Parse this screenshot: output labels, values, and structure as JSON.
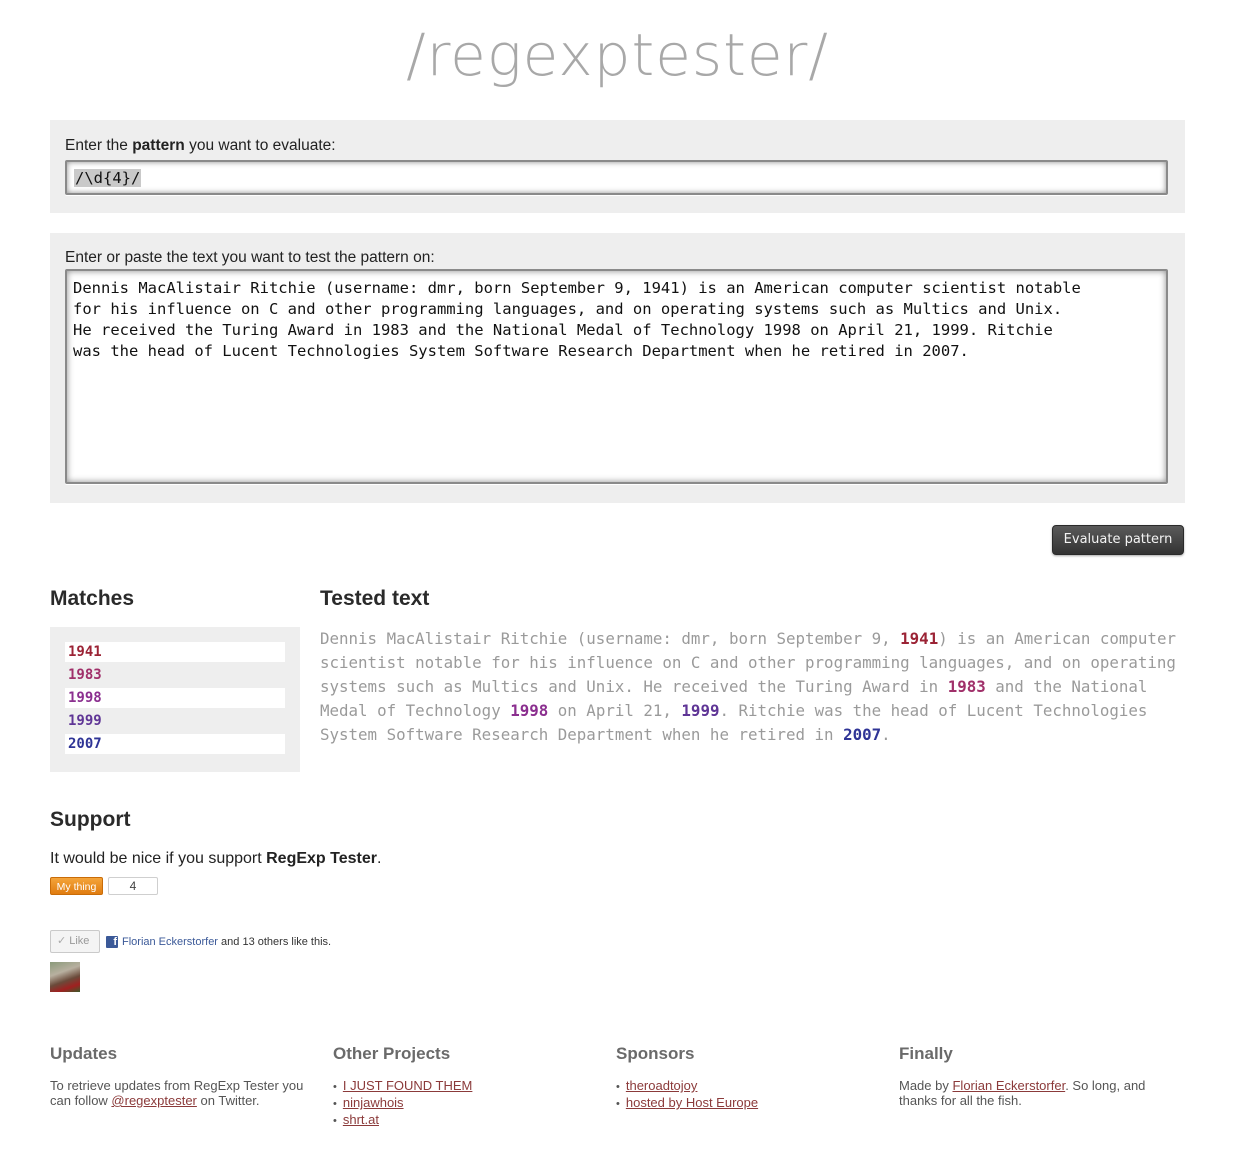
{
  "logo": "/regexptester/",
  "pattern_panel": {
    "label_pre": "Enter the ",
    "label_bold": "pattern",
    "label_post": " you want to evaluate:",
    "value": "/\\d{4}/"
  },
  "text_panel": {
    "label": "Enter or paste the text you want to test the pattern on:",
    "value": "Dennis MacAlistair Ritchie (username: dmr, born September 9, 1941) is an American computer scientist notable\nfor his influence on C and other programming languages, and on operating systems such as Multics and Unix.\nHe received the Turing Award in 1983 and the National Medal of Technology 1998 on April 21, 1999. Ritchie\nwas the head of Lucent Technologies System Software Research Department when he retired in 2007."
  },
  "evaluate_button": "Evaluate pattern",
  "matches": {
    "heading": "Matches",
    "items": [
      {
        "value": "1941",
        "color": "#9b2335"
      },
      {
        "value": "1983",
        "color": "#a0306a"
      },
      {
        "value": "1998",
        "color": "#8b2f8f"
      },
      {
        "value": "1999",
        "color": "#5f3596"
      },
      {
        "value": "2007",
        "color": "#2f3496"
      }
    ]
  },
  "tested": {
    "heading": "Tested text",
    "segments": [
      {
        "text": "Dennis MacAlistair Ritchie (username: dmr, born September 9, "
      },
      {
        "text": "1941",
        "color": "#9b2335"
      },
      {
        "text": ") is an American computer scientist notable for his influence on C and other programming languages, and on operating systems such as Multics and Unix. He received the Turing Award in "
      },
      {
        "text": "1983",
        "color": "#a0306a"
      },
      {
        "text": " and the National Medal of Technology "
      },
      {
        "text": "1998",
        "color": "#8b2f8f"
      },
      {
        "text": " on April 21, "
      },
      {
        "text": "1999",
        "color": "#5f3596"
      },
      {
        "text": ". Ritchie was the head of Lucent Technologies System Software Research Department when he retired in "
      },
      {
        "text": "2007",
        "color": "#2f3496"
      },
      {
        "text": "."
      }
    ]
  },
  "support": {
    "heading": "Support",
    "text_pre": "It would be nice if you support ",
    "text_bold": "RegExp Tester",
    "text_post": ".",
    "mything_label": "My thing",
    "mything_count": "4",
    "like_label": "Like",
    "like_person": "Florian Eckerstorfer",
    "like_rest": " and 13 others like this."
  },
  "footer": {
    "updates": {
      "heading": "Updates",
      "text_pre": "To retrieve updates from RegExp Tester you can follow ",
      "link": "@regexptester",
      "text_post": " on Twitter."
    },
    "projects": {
      "heading": "Other Projects",
      "items": [
        "I JUST FOUND THEM",
        "ninjawhois",
        "shrt.at"
      ]
    },
    "sponsors": {
      "heading": "Sponsors",
      "items": [
        "theroadtojoy",
        "hosted by Host Europe"
      ]
    },
    "finally": {
      "heading": "Finally",
      "text_pre": "Made by ",
      "link": "Florian Eckerstorfer",
      "text_post": ". So long, and thanks for all the fish."
    }
  }
}
